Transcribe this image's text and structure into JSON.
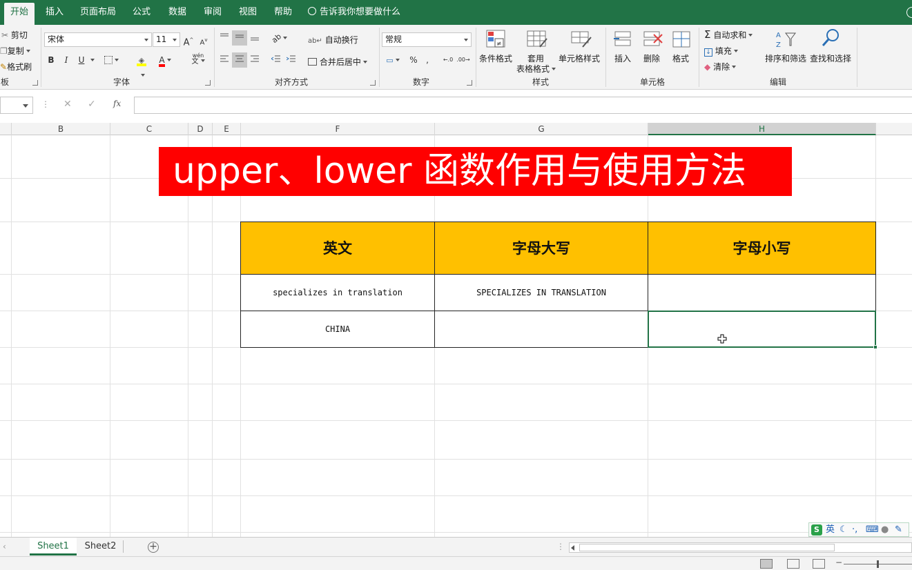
{
  "ribbon_tabs": [
    "开始",
    "插入",
    "页面布局",
    "公式",
    "数据",
    "审阅",
    "视图",
    "帮助"
  ],
  "tell_me": "告诉我你想要做什么",
  "clipboard": {
    "cut": "剪切",
    "copy": "复制",
    "format_painter": "格式刷",
    "label": "板"
  },
  "font": {
    "name": "宋体",
    "size": "11",
    "label": "字体",
    "bold": "B",
    "italic": "I",
    "underline": "U",
    "font_color_letter": "A",
    "wen": "wén",
    "wen_char": "文"
  },
  "alignment": {
    "wrap_text": "自动换行",
    "merge_center": "合并后居中",
    "label": "对齐方式"
  },
  "number": {
    "format": "常规",
    "label": "数字",
    "percent": "%",
    "comma": ","
  },
  "styles": {
    "conditional": "条件格式",
    "table_line1": "套用",
    "table_line2": "表格格式",
    "cell_styles": "单元格样式",
    "label": "样式"
  },
  "cells": {
    "insert": "插入",
    "delete": "删除",
    "format": "格式",
    "label": "单元格"
  },
  "editing": {
    "autosum": "自动求和",
    "fill": "填充",
    "clear": "清除",
    "sort_filter": "排序和筛选",
    "find_select": "查找和选择",
    "label": "编辑"
  },
  "formula_bar": {
    "cancel": "✕",
    "enter": "✓",
    "fx": "fx",
    "value": ""
  },
  "columns": [
    "B",
    "C",
    "D",
    "E",
    "F",
    "G",
    "H"
  ],
  "banner_title": "upper、lower 函数作用与使用方法",
  "table": {
    "headers": [
      "英文",
      "字母大写",
      "字母小写"
    ],
    "rows": [
      [
        "specializes in translation",
        "SPECIALIZES IN TRANSLATION",
        ""
      ],
      [
        "CHINA",
        "",
        ""
      ]
    ]
  },
  "sheets": [
    "Sheet1",
    "Sheet2"
  ],
  "ime": {
    "lang": "英"
  },
  "colors": {
    "excel_green": "#217346",
    "banner_red": "#ff0000",
    "header_fill": "#ffc000"
  }
}
